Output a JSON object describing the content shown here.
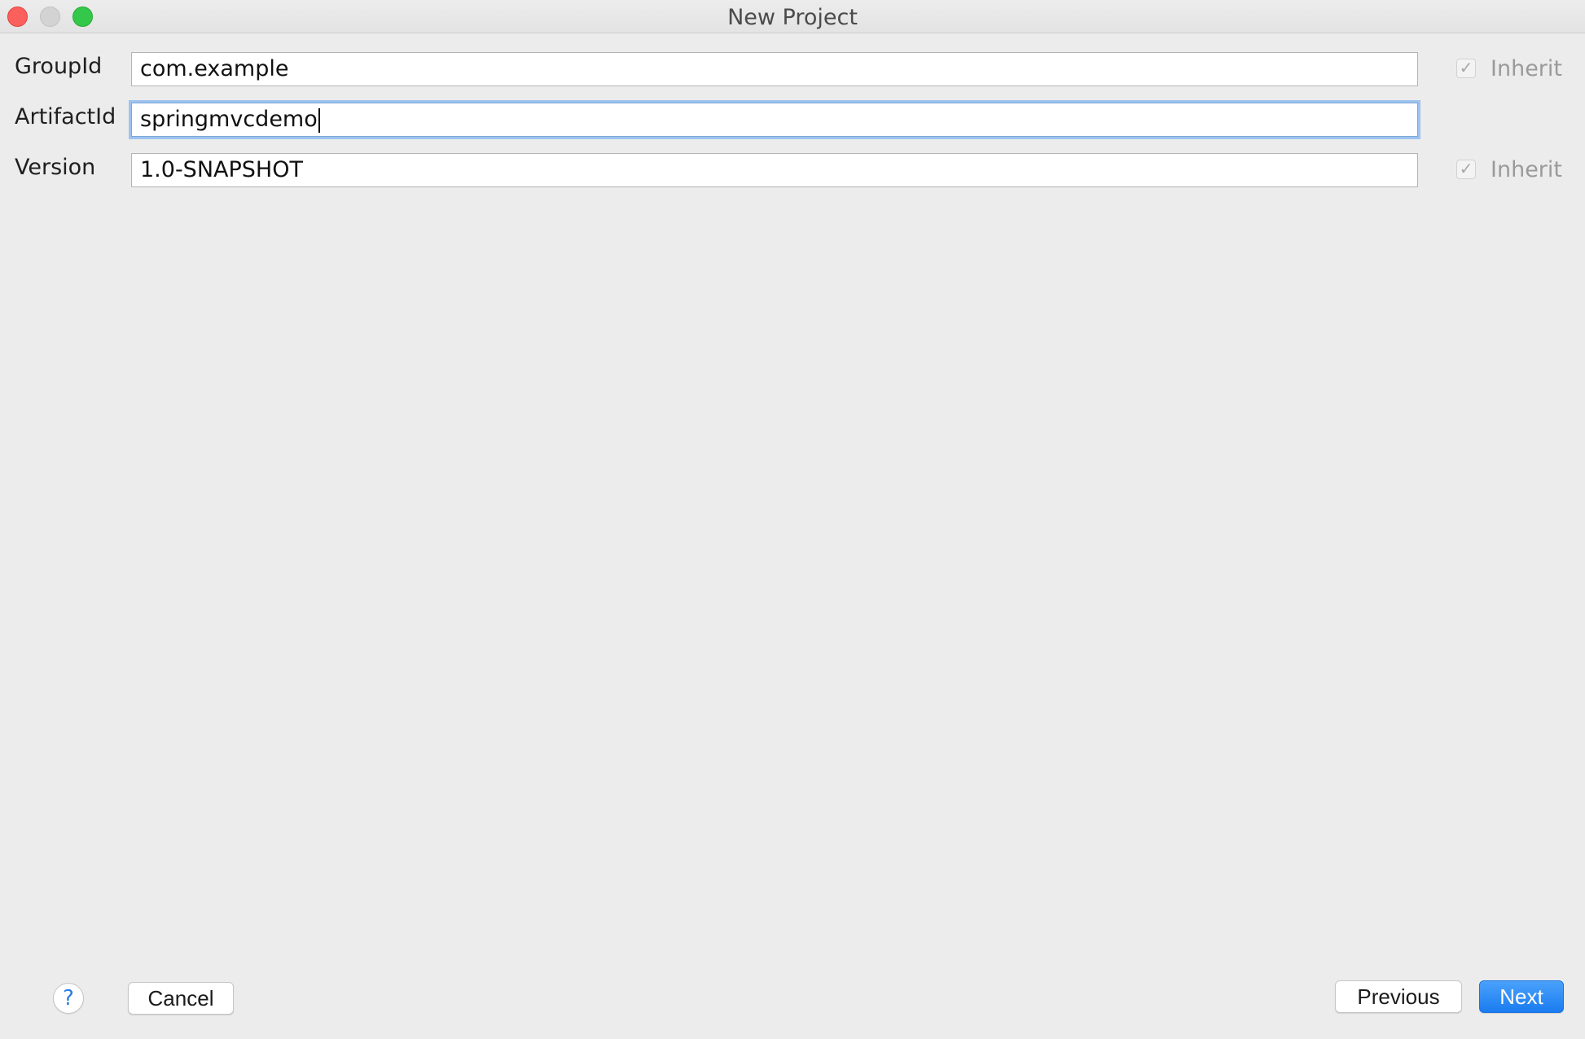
{
  "window": {
    "title": "New Project"
  },
  "form": {
    "group_id": {
      "label": "GroupId",
      "value": "com.example",
      "inherit_label": "Inherit",
      "inherit_checked": true
    },
    "artifact_id": {
      "label": "ArtifactId",
      "value": "springmvcdemo"
    },
    "version": {
      "label": "Version",
      "value": "1.0-SNAPSHOT",
      "inherit_label": "Inherit",
      "inherit_checked": true
    }
  },
  "footer": {
    "help_symbol": "?",
    "cancel_label": "Cancel",
    "previous_label": "Previous",
    "next_label": "Next"
  },
  "colors": {
    "accent": "#1a7cf0",
    "focus_ring": "#9ec3ef"
  }
}
